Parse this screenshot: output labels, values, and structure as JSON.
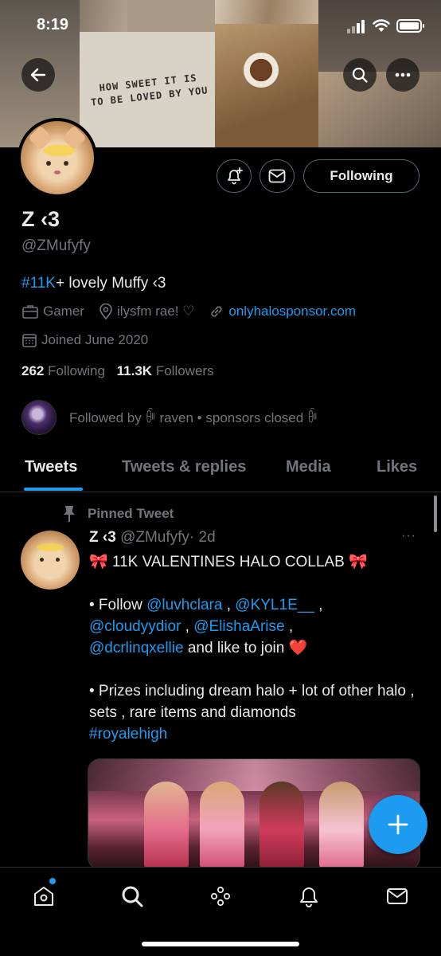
{
  "status_bar": {
    "time": "8:19"
  },
  "banner": {
    "sign_line1": "HOW SWEET IT IS",
    "sign_line2": "TO BE LOVED BY YOU"
  },
  "profile": {
    "name": "Z ‹3",
    "handle": "@ZMufyfy",
    "bio_hashtag": "#11K",
    "bio_rest": "+ lovely Muffy ‹3",
    "category": "Gamer",
    "location": "ilysfm rae! ♡",
    "website": "onlyhalosponsor.com",
    "joined": "Joined June 2020",
    "following_count": "262",
    "following_label": "Following",
    "followers_count": "11.3K",
    "followers_label": "Followers",
    "followed_by": "Followed by ꀼ raven • sponsors closed ꀼ",
    "follow_button": "Following"
  },
  "tabs": [
    {
      "label": "Tweets",
      "active": true
    },
    {
      "label": "Tweets & replies",
      "active": false
    },
    {
      "label": "Media",
      "active": false
    },
    {
      "label": "Likes",
      "active": false
    }
  ],
  "tweet": {
    "pinned_label": "Pinned Tweet",
    "author_name": "Z ‹3",
    "author_handle": "@ZMufyfy",
    "age": "· 2d",
    "more": "···",
    "line1": "🎀 11K VALENTINES HALO COLLAB 🎀",
    "follow_prefix": "• Follow",
    "mention1": "@luvhclara",
    "sep1": " , ",
    "mention2": "@KYL1E__",
    "sep2": " ,",
    "mention3": "@cloudyydior",
    "sep3": " , ",
    "mention4": "@ElishaArise",
    "sep4": " ,",
    "mention5": "@dcrlinqxellie",
    "join_text": " and like to join ❤️",
    "prizes": "• Prizes including dream halo + lot of other halo , sets , rare items and diamonds",
    "hashtag": "#royalehigh"
  },
  "colors": {
    "accent": "#1d9bf0",
    "background": "#000000",
    "text": "#e7e9ea",
    "muted": "#71767b",
    "border": "#2f3336"
  },
  "icons": {
    "back": "back-arrow-icon",
    "search": "search-icon",
    "more": "more-icon",
    "notify": "bell-plus-icon",
    "message": "envelope-icon",
    "home": "home-icon",
    "explore": "search-icon",
    "spaces": "spaces-icon",
    "notifications": "bell-icon",
    "messages": "envelope-icon",
    "compose": "plus-icon"
  }
}
